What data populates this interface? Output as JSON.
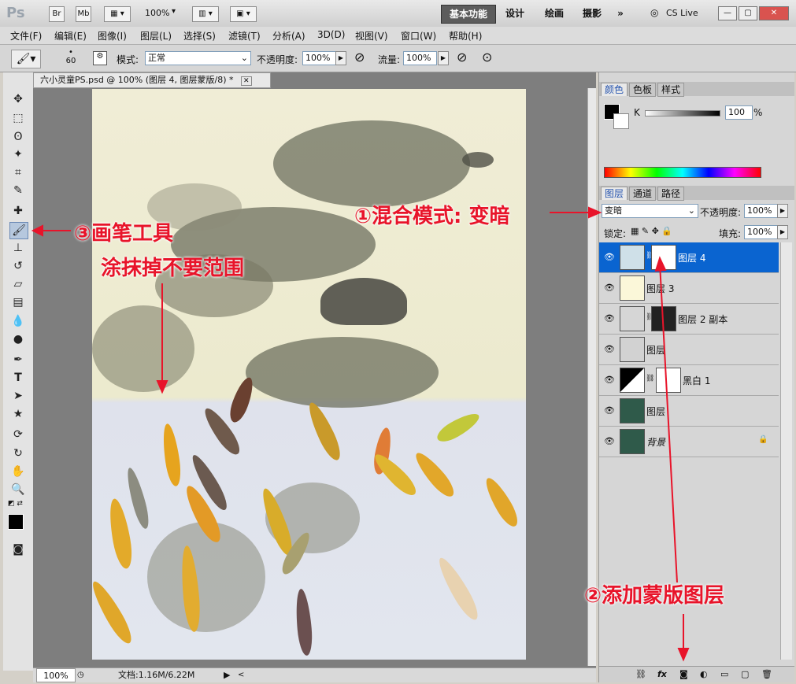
{
  "app": {
    "logo": "Ps",
    "br": "Br",
    "mb": "Mb",
    "zoom": "100%"
  },
  "workspace": {
    "active": "基本功能",
    "design": "设计",
    "paint": "绘画",
    "photo": "摄影",
    "more": "»",
    "cslive": "CS Live"
  },
  "menu": [
    "文件(F)",
    "编辑(E)",
    "图像(I)",
    "图层(L)",
    "选择(S)",
    "滤镜(T)",
    "分析(A)",
    "3D(D)",
    "视图(V)",
    "窗口(W)",
    "帮助(H)"
  ],
  "options": {
    "brush_size": "60",
    "mode_label": "模式:",
    "mode_value": "正常",
    "opacity_label": "不透明度:",
    "opacity_value": "100%",
    "flow_label": "流量:",
    "flow_value": "100%"
  },
  "document": {
    "tab_title": "六小灵童PS.psd @ 100% (图层 4, 图层蒙版/8) *",
    "zoom": "100%",
    "doc_info": "文档:1.16M/6.22M"
  },
  "color_panel": {
    "tabs": [
      "颜色",
      "色板",
      "样式"
    ],
    "channel": "K",
    "value": "100",
    "unit": "%"
  },
  "layers_panel": {
    "tabs": [
      "图层",
      "通道",
      "路径"
    ],
    "blend_mode": "变暗",
    "opacity_label": "不透明度:",
    "opacity_value": "100%",
    "lock_label": "锁定:",
    "fill_label": "填充:",
    "fill_value": "100%",
    "layers": [
      {
        "name": "图层 4"
      },
      {
        "name": "图层 3"
      },
      {
        "name": "图层 2 副本"
      },
      {
        "name": "图层"
      },
      {
        "name": "黑白 1"
      },
      {
        "name": "图层"
      },
      {
        "name": "背景"
      }
    ],
    "footer_icons": [
      "link-icon",
      "fx-icon",
      "mask-icon",
      "adjustment-icon",
      "group-icon",
      "new-layer-icon",
      "trash-icon"
    ]
  },
  "annotations": {
    "a1": "①混合模式: 变暗",
    "a2": "②添加蒙版图层",
    "a3": "③画笔工具",
    "a3_sub": "涂抹掉不要范围"
  },
  "colors": {
    "accent_red": "#e8142a",
    "selection_blue": "#0a64d0",
    "toolbar_bg": "#e3e3e3"
  }
}
